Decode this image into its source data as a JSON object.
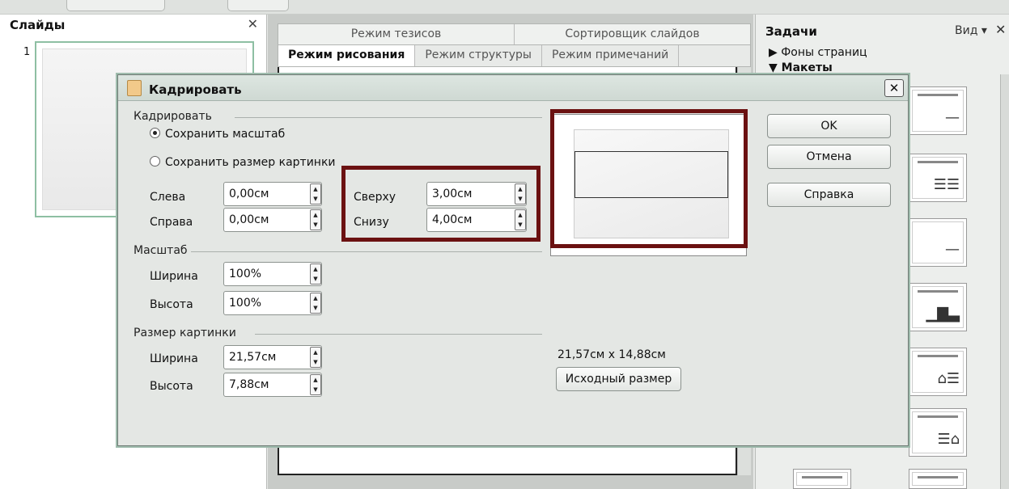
{
  "slides_panel": {
    "title": "Слайды",
    "close": "✕",
    "slide_number": "1"
  },
  "view_tabs": {
    "row1": [
      "Режим тезисов",
      "Сортировщик слайдов"
    ],
    "row2": [
      "Режим рисования",
      "Режим структуры",
      "Режим примечаний"
    ]
  },
  "tasks_panel": {
    "title": "Задачи",
    "view": "Вид ▾",
    "close": "✕",
    "backgrounds": "▶ Фоны страниц",
    "layouts": "▼ Макеты"
  },
  "dialog": {
    "title": "Кадрировать",
    "crop_section": "Кадрировать",
    "keep_scale": "Сохранить масштаб",
    "keep_scale_mnemonic": "м",
    "keep_size": "Сохранить размер картинки",
    "keep_size_mnemonic": "к",
    "left_label": "Слева",
    "left_value": "0,00см",
    "right_label": "Справа",
    "right_value": "0,00см",
    "top_label": "Сверху",
    "top_value": "3,00см",
    "bottom_label": "Снизу",
    "bottom_value": "4,00см",
    "scale_section": "Масштаб",
    "scale_width_label": "Ширина",
    "scale_width_value": "100%",
    "scale_height_label": "Высота",
    "scale_height_value": "100%",
    "size_section": "Размер картинки",
    "size_width_label": "Ширина",
    "size_width_value": "21,57см",
    "size_height_label": "Высота",
    "size_height_value": "7,88см",
    "original_dims": "21,57см x 14,88см",
    "original_size_button": "Исходный размер",
    "ok": "OK",
    "cancel": "Отмена",
    "help": "Справка"
  }
}
